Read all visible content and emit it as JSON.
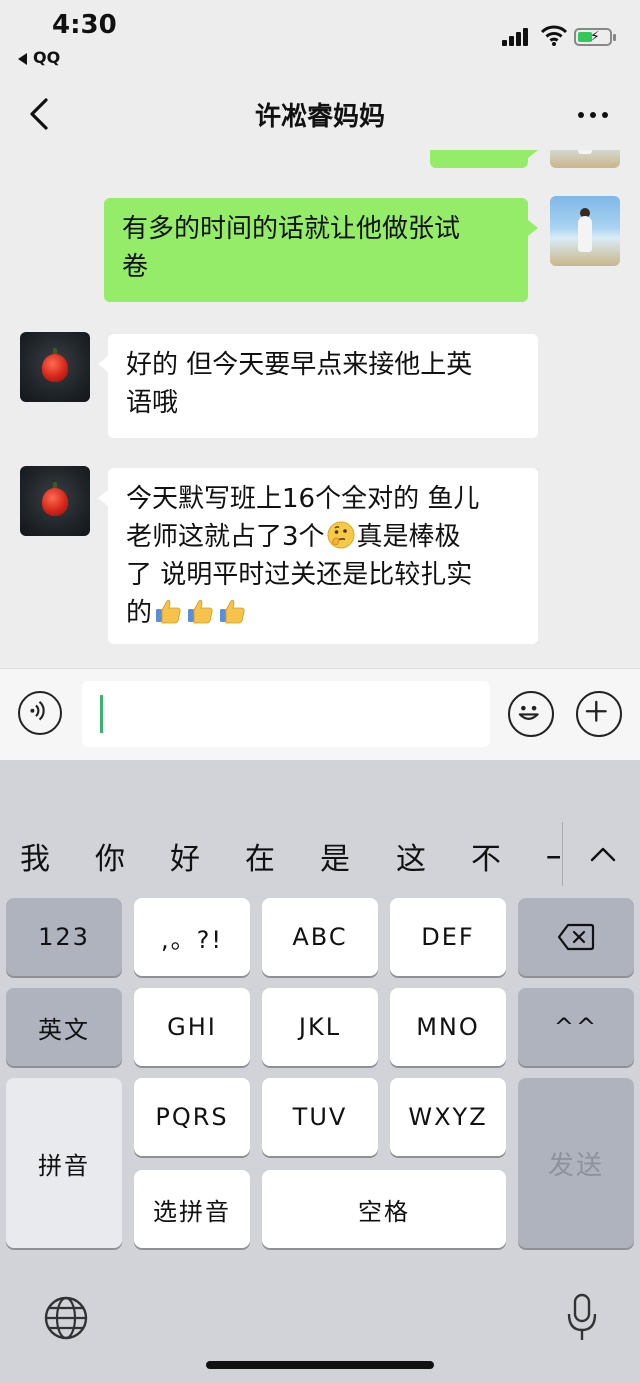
{
  "status_bar": {
    "time": "4:30",
    "back_app": "QQ"
  },
  "nav": {
    "title": "许凇睿妈妈"
  },
  "messages": [
    {
      "from": "me",
      "text": "有多的时间的话就让他做张试卷",
      "line1": "有多的时间的话就让他做张试",
      "line2": "卷"
    },
    {
      "from": "other",
      "line1": "好的 但今天要早点来接他上英",
      "line2": "语哦"
    },
    {
      "from": "other",
      "line1": "今天默写班上16个全对的 鱼儿",
      "line2a": "老师这就占了3个",
      "line2b": "真是棒极",
      "line3": "了 说明平时过关还是比较扎实",
      "line4": "的",
      "emoji_after_line2a": "thinking-face",
      "emoji_line4": [
        "thumbs-up",
        "thumbs-up",
        "thumbs-up"
      ]
    }
  ],
  "input": {
    "value": ""
  },
  "keyboard": {
    "candidates": [
      "我",
      "你",
      "好",
      "在",
      "是",
      "这",
      "不",
      "一"
    ],
    "row1": [
      "123",
      ",。?!",
      "ABC",
      "DEF"
    ],
    "row2": [
      "英文",
      "GHI",
      "JKL",
      "MNO",
      "^^"
    ],
    "row3": [
      "PQRS",
      "TUV",
      "WXYZ"
    ],
    "pinyin": "拼音",
    "select_pinyin": "选拼音",
    "space": "空格",
    "send": "发送"
  },
  "colors": {
    "my_bubble": "#95ec69",
    "other_bubble": "#ffffff",
    "background": "#ededed",
    "keyboard_bg": "#d1d3d9",
    "caret": "#3cb371"
  }
}
